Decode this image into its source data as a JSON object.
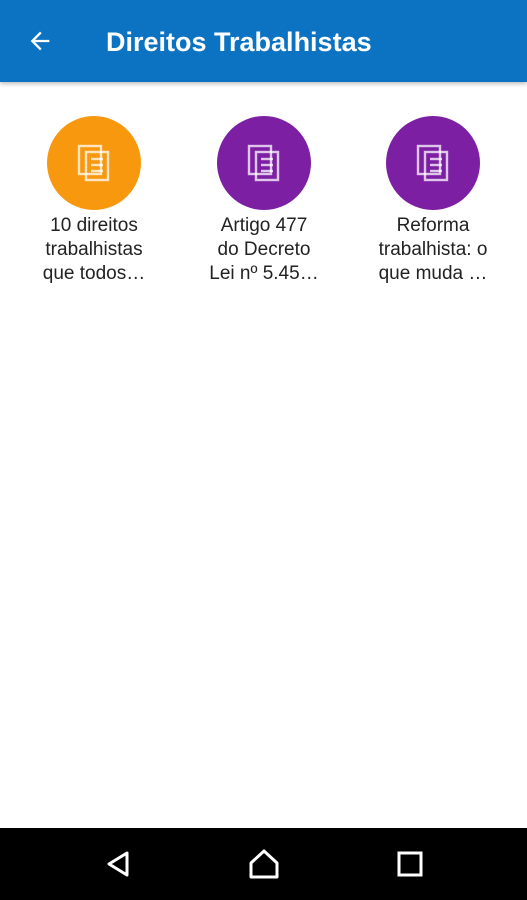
{
  "header": {
    "title": "Direitos Trabalhistas",
    "back_icon": "arrow-back-icon",
    "background": "#0b73c2"
  },
  "items": [
    {
      "label": "10 direitos\ntrabalhistas\nque todos…",
      "color": "#f7980f",
      "icon": "document-icon"
    },
    {
      "label": "Artigo 477\ndo Decreto\nLei nº 5.45…",
      "color": "#7d1fa3",
      "icon": "document-icon"
    },
    {
      "label": "Reforma\ntrabalhista: o\nque muda …",
      "color": "#7d1fa3",
      "icon": "document-icon"
    }
  ],
  "navigation": {
    "back_icon": "nav-back-icon",
    "home_icon": "nav-home-icon",
    "recents_icon": "nav-recents-icon"
  }
}
